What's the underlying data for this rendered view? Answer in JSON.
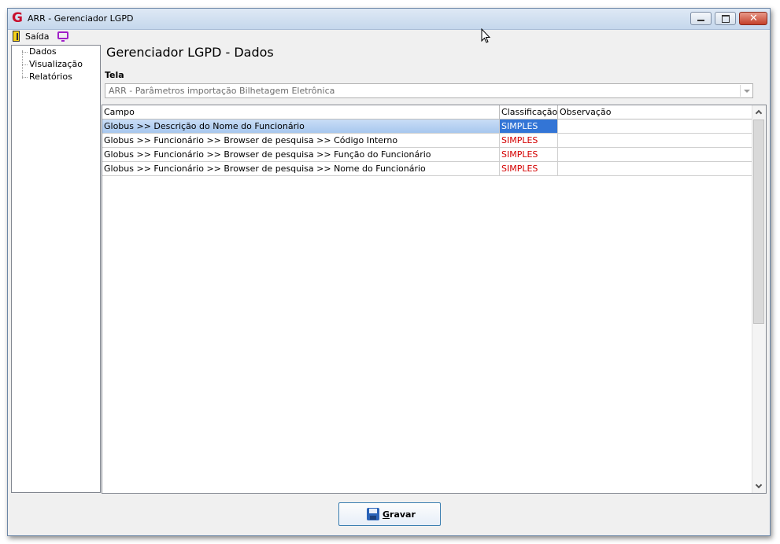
{
  "window": {
    "title": "ARR - Gerenciador LGPD",
    "app_icon_glyph": "G",
    "app_icon_color": "#c8102e"
  },
  "menubar": {
    "exit_label": "Saída",
    "exit_icon": "exit-door-icon",
    "display_icon": "monitor-icon"
  },
  "sidebar": {
    "items": [
      {
        "label": "Dados"
      },
      {
        "label": "Visualização"
      },
      {
        "label": "Relatórios"
      }
    ]
  },
  "main": {
    "title": "Gerenciador LGPD - Dados",
    "tela_label": "Tela",
    "tela_value": "ARR - Parâmetros importação Bilhetagem Eletrônica"
  },
  "grid": {
    "columns": [
      "Campo",
      "Classificação",
      "Observação"
    ],
    "rows": [
      {
        "campo": "Globus >> Descrição do Nome do Funcionário",
        "classificacao": "SIMPLES",
        "observacao": "",
        "selected": true
      },
      {
        "campo": "Globus >> Funcionário >> Browser de pesquisa >> Código Interno",
        "classificacao": "SIMPLES",
        "observacao": ""
      },
      {
        "campo": "Globus >> Funcionário >> Browser de pesquisa >> Função do Funcionário",
        "classificacao": "SIMPLES",
        "observacao": ""
      },
      {
        "campo": "Globus >> Funcionário >> Browser de pesquisa >> Nome do Funcionário",
        "classificacao": "SIMPLES",
        "observacao": ""
      }
    ],
    "classification_color": "#d40000",
    "selected_color": "#3375d6"
  },
  "footer": {
    "save_label": "Gravar",
    "save_icon": "floppy-disk-icon"
  }
}
